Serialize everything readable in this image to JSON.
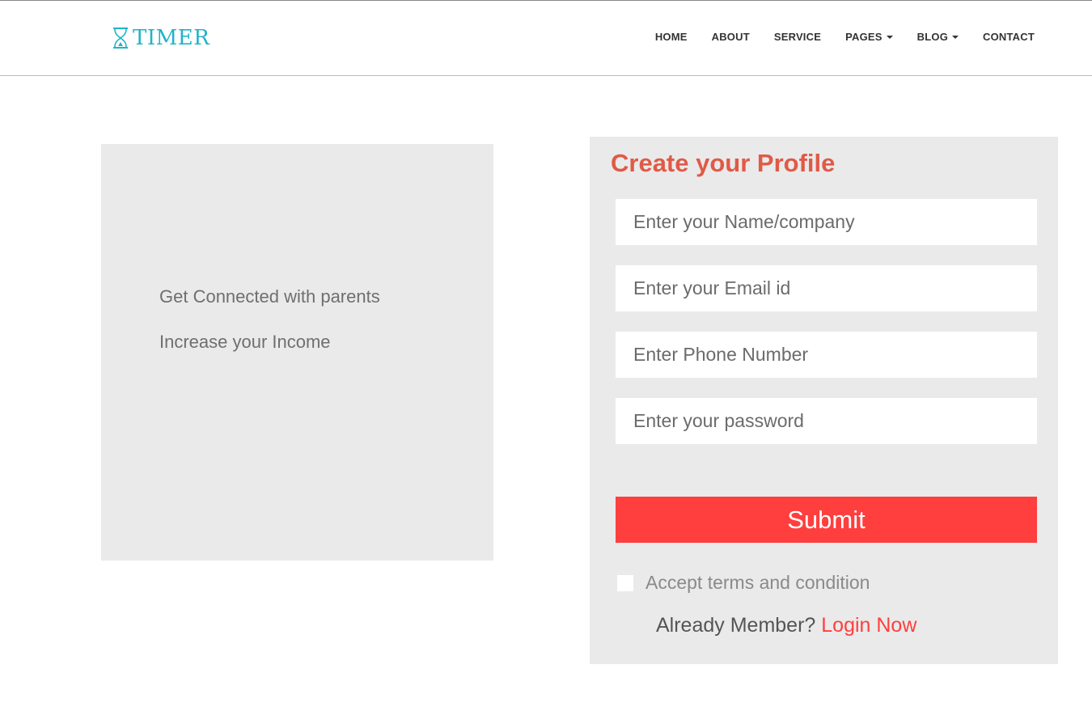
{
  "brand": {
    "name": "TIMER",
    "icon": "hourglass-icon",
    "color": "#1fb4c9"
  },
  "nav": {
    "items": [
      {
        "label": "HOME"
      },
      {
        "label": "ABOUT"
      },
      {
        "label": "SERVICE"
      },
      {
        "label": "PAGES",
        "has_dropdown": true
      },
      {
        "label": "BLOG",
        "has_dropdown": true
      },
      {
        "label": "CONTACT"
      }
    ]
  },
  "features": {
    "items": [
      "Get Connected with parents",
      "Increase your Income"
    ]
  },
  "form": {
    "title": "Create your Profile",
    "title_color": "#e05a47",
    "fields": [
      {
        "placeholder": "Enter your Name/company",
        "value": ""
      },
      {
        "placeholder": "Enter your Email id",
        "value": ""
      },
      {
        "placeholder": "Enter Phone Number",
        "value": ""
      },
      {
        "placeholder": "Enter your password",
        "value": ""
      }
    ],
    "submit_label": "Submit",
    "submit_color": "#ff3e3e",
    "terms_label": "Accept terms and condition",
    "terms_checked": false,
    "member_label": "Already Member?",
    "login_label": "Login Now"
  }
}
